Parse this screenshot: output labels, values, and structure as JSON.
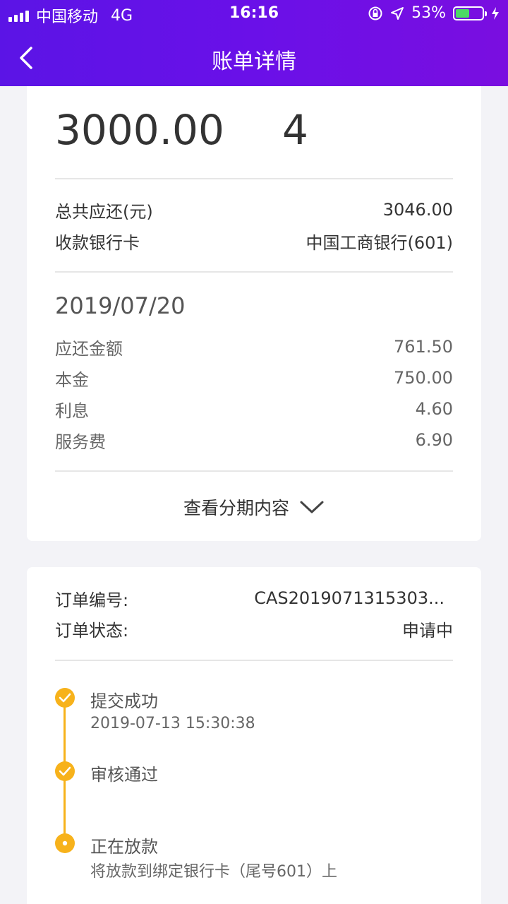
{
  "status_bar": {
    "carrier": "中国移动",
    "network": "4G",
    "time": "16:16",
    "battery_percent": "53%",
    "battery_level": 0.53
  },
  "nav": {
    "title": "账单详情"
  },
  "summary": {
    "amount": "3000.00",
    "installments": "4",
    "total_label": "总共应还(元)",
    "total_value": "3046.00",
    "bank_label": "收款银行卡",
    "bank_value": "中国工商银行(601)"
  },
  "installment": {
    "date": "2019/07/20",
    "rows": [
      {
        "label": "应还金额",
        "value": "761.50"
      },
      {
        "label": "本金",
        "value": "750.00"
      },
      {
        "label": "利息",
        "value": "4.60"
      },
      {
        "label": "服务费",
        "value": "6.90"
      }
    ],
    "expand_label": "查看分期内容"
  },
  "order": {
    "number_label": "订单编号:",
    "number_value": "CAS2019071315303...",
    "status_label": "订单状态:",
    "status_value": "申请中"
  },
  "timeline": [
    {
      "title": "提交成功",
      "sub": "2019-07-13 15:30:38"
    },
    {
      "title": "审核通过",
      "sub": ""
    },
    {
      "title": "正在放款",
      "sub": "将放款到绑定银行卡（尾号601）上"
    }
  ],
  "colors": {
    "header": "#6a10e8",
    "timeline": "#f7b21b",
    "battery": "#4cd964"
  }
}
